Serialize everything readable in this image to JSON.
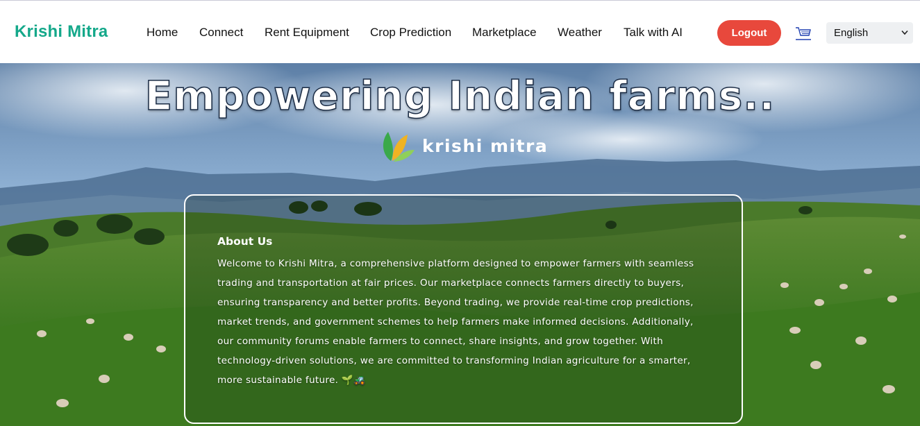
{
  "brand": {
    "name": "Krishi Mitra",
    "color": "#14a88a"
  },
  "nav": {
    "items": [
      {
        "label": "Home"
      },
      {
        "label": "Connect"
      },
      {
        "label": "Rent Equipment"
      },
      {
        "label": "Crop Prediction"
      },
      {
        "label": "Marketplace"
      },
      {
        "label": "Weather"
      },
      {
        "label": "Talk with AI"
      }
    ],
    "logout_label": "Logout",
    "logout_color": "#e8483c",
    "cart_icon": "cart-icon",
    "language": {
      "selected": "English"
    }
  },
  "hero": {
    "title": "Empowering Indian farms..",
    "logo_text": "krishi mitra",
    "about": {
      "title": "About Us",
      "body": "Welcome to Krishi Mitra, a comprehensive platform designed to empower farmers with seamless trading and transportation at fair prices. Our marketplace connects farmers directly to buyers, ensuring transparency and better profits. Beyond trading, we provide real-time crop predictions, market trends, and government schemes to help farmers make informed decisions. Additionally, our community forums enable farmers to connect, share insights, and grow together. With technology-driven solutions, we are committed to transforming Indian agriculture for a smarter, more sustainable future. 🌱🚜"
    }
  }
}
